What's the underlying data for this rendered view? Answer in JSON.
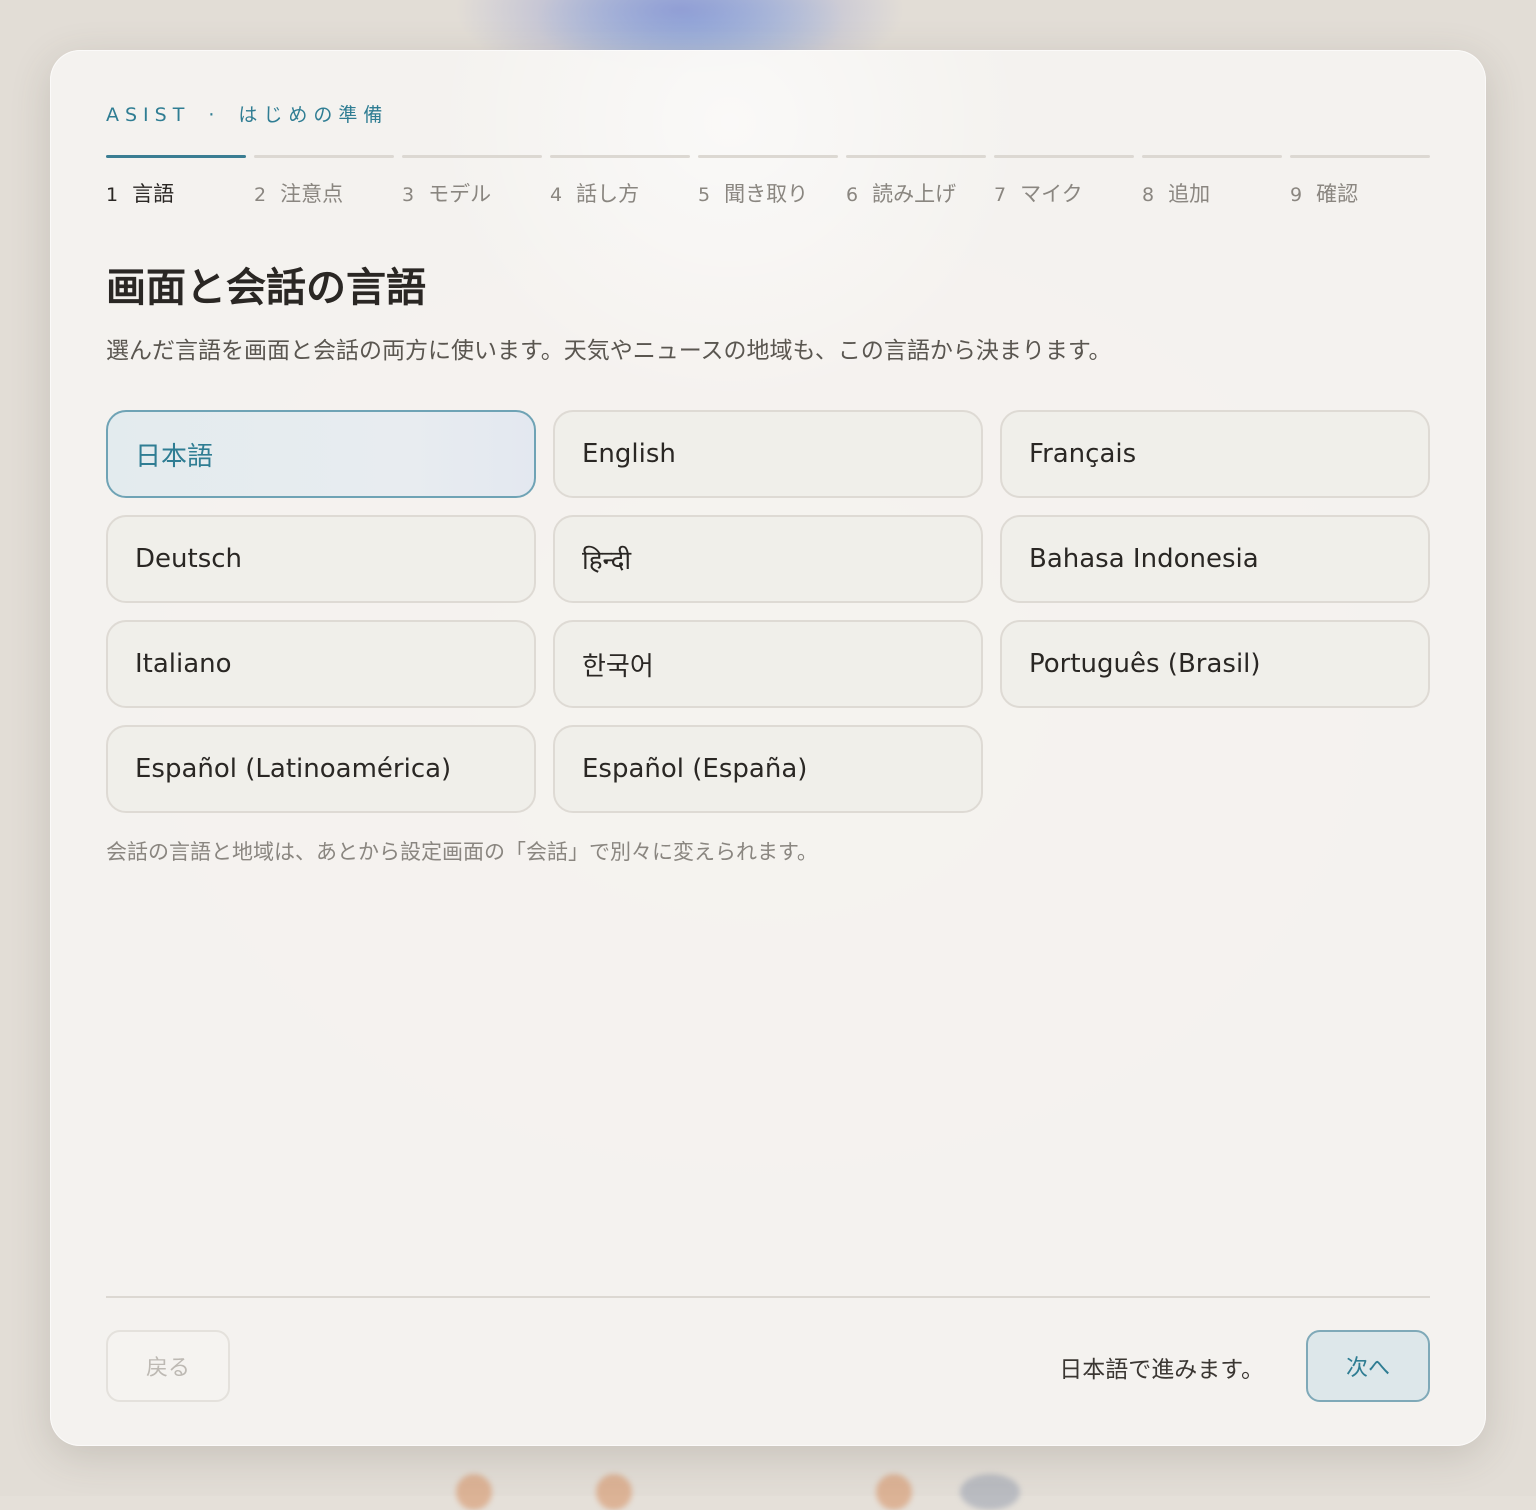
{
  "header": {
    "brand": "ASIST",
    "separator": "·",
    "subtitle": "はじめの準備"
  },
  "steps": [
    {
      "num": "1",
      "label": "言語",
      "active": true
    },
    {
      "num": "2",
      "label": "注意点"
    },
    {
      "num": "3",
      "label": "モデル"
    },
    {
      "num": "4",
      "label": "話し方"
    },
    {
      "num": "5",
      "label": "聞き取り"
    },
    {
      "num": "6",
      "label": "読み上げ"
    },
    {
      "num": "7",
      "label": "マイク"
    },
    {
      "num": "8",
      "label": "追加"
    },
    {
      "num": "9",
      "label": "確認"
    }
  ],
  "main": {
    "title": "画面と会話の言語",
    "description": "選んだ言語を画面と会話の両方に使います。天気やニュースの地域も、この言語から決まります。",
    "languages": [
      {
        "label": "日本語",
        "selected": true
      },
      {
        "label": "English"
      },
      {
        "label": "Français"
      },
      {
        "label": "Deutsch"
      },
      {
        "label": "हिन्दी"
      },
      {
        "label": "Bahasa Indonesia"
      },
      {
        "label": "Italiano"
      },
      {
        "label": "한국어"
      },
      {
        "label": "Português (Brasil)"
      },
      {
        "label": "Español (Latinoamérica)"
      },
      {
        "label": "Español (España)"
      }
    ],
    "note": "会話の言語と地域は、あとから設定画面の「会話」で別々に変えられます。"
  },
  "footer": {
    "back_label": "戻る",
    "status": "日本語で進みます。",
    "next_label": "次へ"
  },
  "colors": {
    "accent": "#2f7d93",
    "text": "#2a2724",
    "muted": "#8a8680"
  }
}
